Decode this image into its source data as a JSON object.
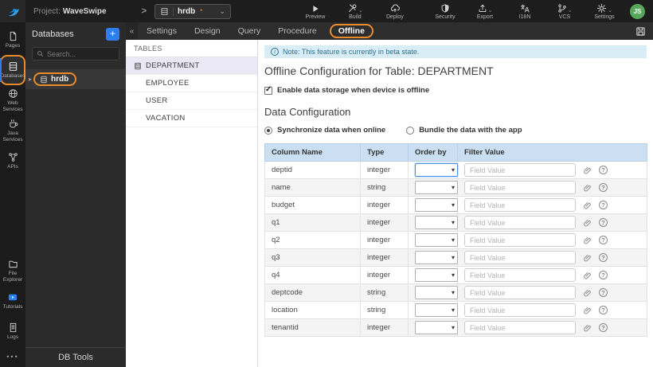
{
  "colors": {
    "annotation_orange": "#E98A2B",
    "accent_blue": "#2D7FF0",
    "note_bg": "#D9EDF7",
    "note_text": "#31708F",
    "table_header_bg": "#CBDFF2",
    "avatar_green": "#57A85C",
    "logo_blue": "#2DA0E8"
  },
  "icons": {
    "plus": "+",
    "caret_down": "⌄",
    "chevron_right": ">",
    "collapse_left": "«",
    "expander": "▸",
    "select_caret": "▾",
    "ellipsis": "•••",
    "help": "?",
    "info": "i",
    "check": "✓",
    "asterisk": "*"
  },
  "topbar": {
    "project_label": "Project:",
    "project_name": "WaveSwipe",
    "db_selector": {
      "value": "hrdb"
    },
    "preview": "Preview",
    "build": "Build",
    "deploy": "Deploy",
    "security": "Security",
    "export": "Export",
    "i18n": "I18N",
    "vcs": "VCS",
    "settings": "Settings",
    "avatar_initials": "JS"
  },
  "sidebar": {
    "top": [
      {
        "label": "Pages"
      },
      {
        "label": "Databases",
        "active": true
      },
      {
        "label": "Web Services"
      },
      {
        "label": "Java Services"
      },
      {
        "label": "APIs"
      }
    ],
    "bottom": [
      {
        "label": "File Explorer"
      },
      {
        "label": "Tutorials"
      },
      {
        "label": "Logs"
      }
    ]
  },
  "db_panel": {
    "title": "Databases",
    "search_placeholder": "Search...",
    "items": [
      {
        "label": "hrdb"
      }
    ],
    "footer": "DB Tools"
  },
  "content": {
    "tabs": [
      {
        "label": "Settings"
      },
      {
        "label": "Design"
      },
      {
        "label": "Query"
      },
      {
        "label": "Procedure"
      },
      {
        "label": "Offline",
        "active": true
      }
    ]
  },
  "tables_panel": {
    "header": "TABLES",
    "items": [
      {
        "label": "DEPARTMENT",
        "selected": true
      },
      {
        "label": "EMPLOYEE"
      },
      {
        "label": "USER"
      },
      {
        "label": "VACATION"
      }
    ]
  },
  "main": {
    "note": "Note: This feature is currently in beta state.",
    "title": "Offline Configuration for Table: DEPARTMENT",
    "enable_label": "Enable data storage when device is offline",
    "enable_checked": true,
    "section_title": "Data Configuration",
    "radios": [
      {
        "label": "Synchronize data when online",
        "selected": true
      },
      {
        "label": "Bundle the data with the app",
        "selected": false
      }
    ],
    "table": {
      "headers": [
        "Column Name",
        "Type",
        "Order by",
        "Filter Value"
      ],
      "filter_placeholder": "Field Value",
      "rows": [
        {
          "column": "deptid",
          "type": "integer"
        },
        {
          "column": "name",
          "type": "string"
        },
        {
          "column": "budget",
          "type": "integer"
        },
        {
          "column": "q1",
          "type": "integer"
        },
        {
          "column": "q2",
          "type": "integer"
        },
        {
          "column": "q3",
          "type": "integer"
        },
        {
          "column": "q4",
          "type": "integer"
        },
        {
          "column": "deptcode",
          "type": "string"
        },
        {
          "column": "location",
          "type": "string"
        },
        {
          "column": "tenantid",
          "type": "integer"
        }
      ]
    }
  }
}
